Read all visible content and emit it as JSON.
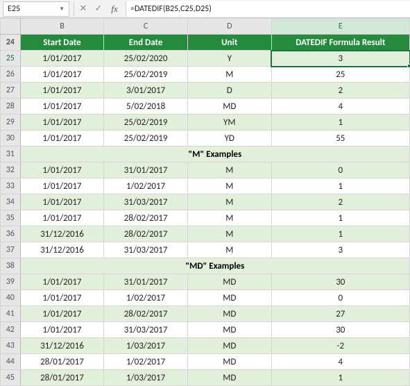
{
  "namebox": "E25",
  "formula": "=DATEDIF(B25,C25,D25)",
  "columns": [
    "B",
    "C",
    "D",
    "E"
  ],
  "header": {
    "row": "24",
    "labels": [
      "Start Date",
      "End Date",
      "Unit",
      "DATEDIF Formula Result"
    ]
  },
  "selected": {
    "row": "25",
    "col": "E"
  },
  "rows": [
    {
      "num": "25",
      "band": true,
      "cells": [
        "1/01/2017",
        "25/02/2020",
        "Y",
        "3"
      ]
    },
    {
      "num": "26",
      "band": false,
      "cells": [
        "1/01/2017",
        "25/02/2019",
        "M",
        "25"
      ]
    },
    {
      "num": "27",
      "band": true,
      "cells": [
        "1/01/2017",
        "3/01/2017",
        "D",
        "2"
      ]
    },
    {
      "num": "28",
      "band": false,
      "cells": [
        "1/01/2017",
        "5/02/2018",
        "MD",
        "4"
      ]
    },
    {
      "num": "29",
      "band": true,
      "cells": [
        "1/01/2017",
        "25/02/2019",
        "YM",
        "1"
      ]
    },
    {
      "num": "30",
      "band": false,
      "cells": [
        "1/01/2017",
        "25/02/2019",
        "YD",
        "55"
      ]
    },
    {
      "num": "31",
      "band": true,
      "section": "\"M\" Examples"
    },
    {
      "num": "32",
      "band": true,
      "cells": [
        "1/01/2017",
        "31/01/2017",
        "M",
        "0"
      ]
    },
    {
      "num": "33",
      "band": false,
      "cells": [
        "1/01/2017",
        "1/02/2017",
        "M",
        "1"
      ]
    },
    {
      "num": "34",
      "band": true,
      "cells": [
        "1/01/2017",
        "31/03/2017",
        "M",
        "2"
      ]
    },
    {
      "num": "35",
      "band": false,
      "cells": [
        "1/01/2017",
        "28/02/2017",
        "M",
        "1"
      ]
    },
    {
      "num": "36",
      "band": true,
      "cells": [
        "31/12/2016",
        "28/02/2017",
        "M",
        "1"
      ]
    },
    {
      "num": "37",
      "band": false,
      "cells": [
        "31/12/2016",
        "31/03/2017",
        "M",
        "3"
      ]
    },
    {
      "num": "38",
      "band": true,
      "section": "\"MD\" Examples"
    },
    {
      "num": "39",
      "band": true,
      "cells": [
        "1/01/2017",
        "31/01/2017",
        "MD",
        "30"
      ]
    },
    {
      "num": "40",
      "band": false,
      "cells": [
        "1/01/2017",
        "1/02/2017",
        "MD",
        "0"
      ]
    },
    {
      "num": "41",
      "band": true,
      "cells": [
        "1/01/2017",
        "28/02/2017",
        "MD",
        "27"
      ]
    },
    {
      "num": "42",
      "band": false,
      "cells": [
        "1/01/2017",
        "31/03/2017",
        "MD",
        "30"
      ]
    },
    {
      "num": "43",
      "band": true,
      "cells": [
        "31/12/2016",
        "1/03/2017",
        "MD",
        "-2"
      ]
    },
    {
      "num": "44",
      "band": false,
      "cells": [
        "28/01/2017",
        "1/02/2017",
        "MD",
        "4"
      ]
    },
    {
      "num": "45",
      "band": true,
      "cells": [
        "28/01/2017",
        "1/03/2017",
        "MD",
        "1"
      ]
    }
  ],
  "icons": {
    "cancel": "✕",
    "enter": "✓",
    "dropdown": "▼"
  }
}
